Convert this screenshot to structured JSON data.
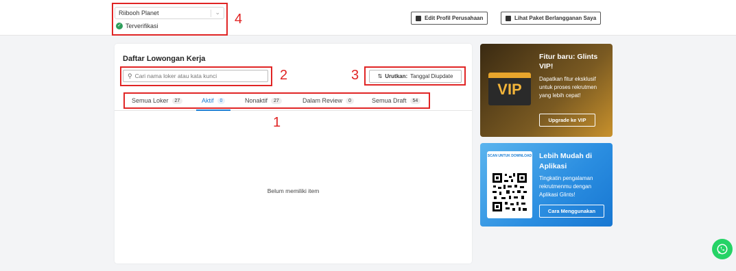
{
  "header": {
    "company_name": "Riibooh Planet",
    "verified_label": "Terverifikasi",
    "edit_profile_label": "Edit Profil Perusahaan",
    "subscription_label": "Lihat Paket Berlangganan Saya"
  },
  "jobs_panel": {
    "title": "Daftar Lowongan Kerja",
    "search_placeholder": "Cari nama loker atau kata kunci",
    "sort_prefix": "Urutkan:",
    "sort_value": "Tanggal Diupdate",
    "tabs": [
      {
        "label": "Semua Loker",
        "count": "27"
      },
      {
        "label": "Aktif",
        "count": "0"
      },
      {
        "label": "Nonaktif",
        "count": "27"
      },
      {
        "label": "Dalam Review",
        "count": "0"
      },
      {
        "label": "Semua Draft",
        "count": "54"
      }
    ],
    "empty_text": "Belum memiliki item"
  },
  "vip_card": {
    "badge_text": "VIP",
    "title": "Fitur baru: Glints VIP!",
    "description": "Dapatkan fitur eksklusif untuk proses rekrutmen yang lebih cepat!",
    "button_label": "Upgrade ke VIP"
  },
  "app_card": {
    "qr_label": "SCAN UNTUK DOWNLOAD",
    "title": "Lebih Mudah di Aplikasi",
    "description": "Tingkatin pengalaman rekrutmenmu dengan Aplikasi Glints!",
    "button_label": "Cara Menggunakan"
  },
  "annotations": [
    "1",
    "2",
    "3",
    "4"
  ],
  "colors": {
    "accent": "#1a7ed4",
    "annotation": "#e02424",
    "verified": "#2e9e5b",
    "whatsapp": "#25d366"
  }
}
